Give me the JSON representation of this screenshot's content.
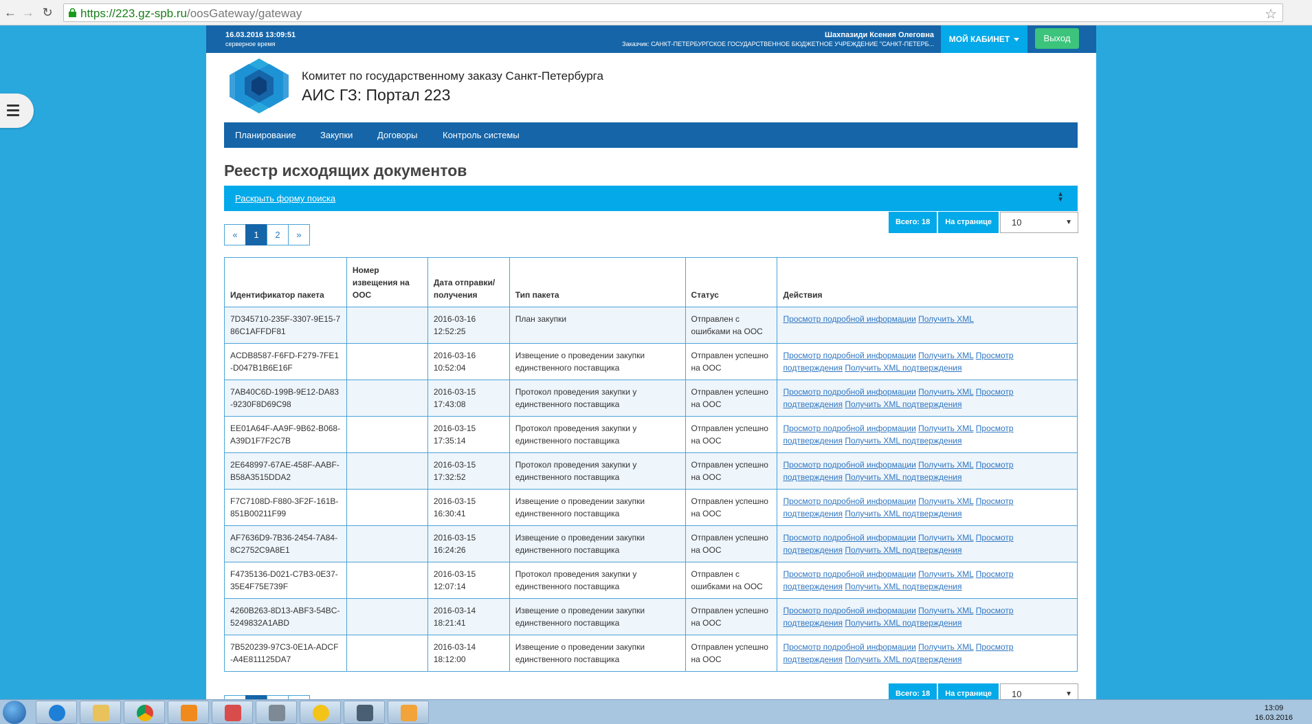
{
  "browser": {
    "url_host": "https://223.gz-spb.ru",
    "url_path": "/oosGateway/gateway"
  },
  "header": {
    "server_time": "16.03.2016 13:09:51",
    "server_time_label": "серверное время",
    "user_name": "Шахпазиди Ксения Олеговна",
    "customer": "Заказчик: САНКТ-ПЕТЕРБУРГСКОЕ ГОСУДАРСТВЕННОЕ БЮДЖЕТНОЕ УЧРЕЖДЕНИЕ \"САНКТ-ПЕТЕРБ...",
    "cabinet_label": "МОЙ КАБИНЕТ",
    "logout_label": "Выход"
  },
  "brand": {
    "org_name": "Комитет по государственному заказу Санкт-Петербурга",
    "portal_name": "АИС ГЗ: Портал 223"
  },
  "nav": {
    "items": [
      "Планирование",
      "Закупки",
      "Договоры",
      "Контроль системы"
    ]
  },
  "page": {
    "title": "Реестр исходящих документов",
    "search_toggle": "Раскрыть форму поиска"
  },
  "pagination": {
    "prev": "«",
    "pages": [
      "1",
      "2"
    ],
    "next": "»",
    "total_label": "Всего: 18",
    "per_page_label": "На странице",
    "per_page_value": "10"
  },
  "table": {
    "headers": [
      "Идентификатор пакета",
      "Номер извещения на ООС",
      "Дата отправки/ получения",
      "Тип пакета",
      "Статус",
      "Действия"
    ],
    "action_labels": {
      "details": "Просмотр подробной информации",
      "xml": "Получить XML",
      "view_confirm": "Просмотр подтверждения",
      "xml_confirm": "Получить XML подтверждения"
    },
    "rows": [
      {
        "id": "7D345710-235F-3307-9E15-786C1AFFDF81",
        "notice": "",
        "date": "2016-03-16",
        "time": "12:52:25",
        "type": "План закупки",
        "status": "Отправлен с ошибками на ООС"
      },
      {
        "id": "ACDB8587-F6FD-F279-7FE1-D047B1B6E16F",
        "notice": "",
        "date": "2016-03-16",
        "time": "10:52:04",
        "type": "Извещение о проведении закупки единственного поставщика",
        "status": "Отправлен успешно на ООС"
      },
      {
        "id": "7AB40C6D-199B-9E12-DA83-9230F8D69C98",
        "notice": "",
        "date": "2016-03-15",
        "time": "17:43:08",
        "type": "Протокол проведения закупки у единственного поставщика",
        "status": "Отправлен успешно на ООС"
      },
      {
        "id": "EE01A64F-AA9F-9B62-B068-A39D1F7F2C7B",
        "notice": "",
        "date": "2016-03-15",
        "time": "17:35:14",
        "type": "Протокол проведения закупки у единственного поставщика",
        "status": "Отправлен успешно на ООС"
      },
      {
        "id": "2E648997-67AE-458F-AABF-B58A3515DDA2",
        "notice": "",
        "date": "2016-03-15",
        "time": "17:32:52",
        "type": "Протокол проведения закупки у единственного поставщика",
        "status": "Отправлен успешно на ООС"
      },
      {
        "id": "F7C7108D-F880-3F2F-161B-851B00211F99",
        "notice": "",
        "date": "2016-03-15",
        "time": "16:30:41",
        "type": "Извещение о проведении закупки единственного поставщика",
        "status": "Отправлен успешно на ООС"
      },
      {
        "id": "AF7636D9-7B36-2454-7A84-8C2752C9A8E1",
        "notice": "",
        "date": "2016-03-15",
        "time": "16:24:26",
        "type": "Извещение о проведении закупки единственного поставщика",
        "status": "Отправлен успешно на ООС"
      },
      {
        "id": "F4735136-D021-C7B3-0E37-35E4F75E739F",
        "notice": "",
        "date": "2016-03-15",
        "time": "12:07:14",
        "type": "Протокол проведения закупки у единственного поставщика",
        "status": "Отправлен с ошибками на ООС"
      },
      {
        "id": "4260B263-8D13-ABF3-54BC-5249832A1ABD",
        "notice": "",
        "date": "2016-03-14",
        "time": "18:21:41",
        "type": "Извещение о проведении закупки единственного поставщика",
        "status": "Отправлен успешно на ООС"
      },
      {
        "id": "7B520239-97C3-0E1A-ADCF-A4E811125DA7",
        "notice": "",
        "date": "2016-03-14",
        "time": "18:12:00",
        "type": "Извещение о проведении закупки единственного поставщика",
        "status": "Отправлен успешно на ООС"
      }
    ]
  },
  "taskbar": {
    "time": "13:09",
    "date": "16.03.2016"
  },
  "colors": {
    "background": "#29a8de",
    "header_blue": "#1565a8",
    "accent_cyan": "#03a9e8",
    "logout_green": "#3cc37c",
    "link": "#2f76c1"
  }
}
